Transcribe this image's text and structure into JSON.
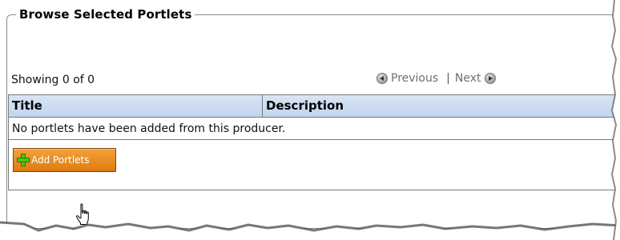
{
  "groupbox": {
    "legend": "Browse Selected Portlets"
  },
  "summary": {
    "showing_text": "Showing 0 of 0"
  },
  "pager": {
    "previous_label": "Previous",
    "separator": "|",
    "next_label": "Next"
  },
  "table": {
    "columns": [
      "Title",
      "Description"
    ],
    "empty_message": "No portlets have been added from this producer."
  },
  "actions": {
    "add_portlets_label": "Add Portlets"
  },
  "icons": {
    "add": "plus-icon",
    "previous": "arrow-left-circle-icon",
    "next": "arrow-right-circle-icon",
    "cursor": "hand-pointer-icon"
  },
  "colors": {
    "header_bg": "#c9d9ef",
    "button_bg": "#e88a1d",
    "plus_green": "#4fc11a"
  }
}
